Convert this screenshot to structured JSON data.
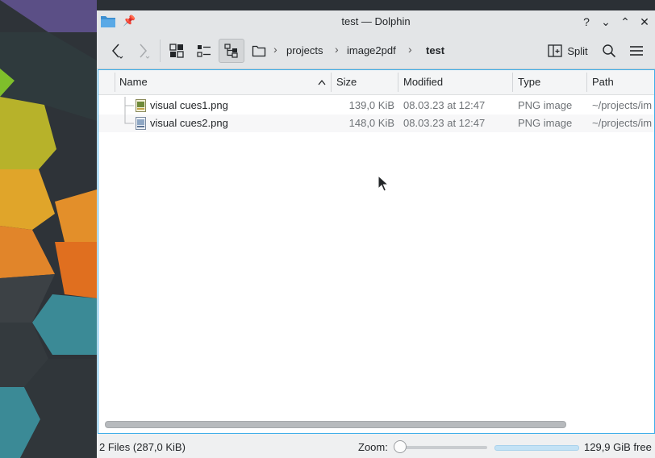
{
  "window": {
    "title": "test — Dolphin",
    "controls": {
      "help": "?",
      "minimize": "⌄",
      "maximize": "⌃",
      "close": "✕"
    }
  },
  "toolbar": {
    "split_label": "Split",
    "breadcrumbs": [
      "projects",
      "image2pdf",
      "test"
    ]
  },
  "columns": [
    "Name",
    "Size",
    "Modified",
    "Type",
    "Path"
  ],
  "files": [
    {
      "name": "visual cues1.png",
      "size": "139,0 KiB",
      "modified": "08.03.23 at 12:47",
      "type": "PNG image",
      "path": "~/projects/im"
    },
    {
      "name": "visual cues2.png",
      "size": "148,0 KiB",
      "modified": "08.03.23 at 12:47",
      "type": "PNG image",
      "path": "~/projects/im"
    }
  ],
  "status": {
    "summary": "2 Files (287,0 KiB)",
    "zoom_label": "Zoom:",
    "zoom_level": 0.0,
    "free_space": "129,9 GiB free",
    "used_fraction": 1.0
  },
  "colors": {
    "accent": "#3daee9",
    "titlebar": "#e3e5e7"
  }
}
